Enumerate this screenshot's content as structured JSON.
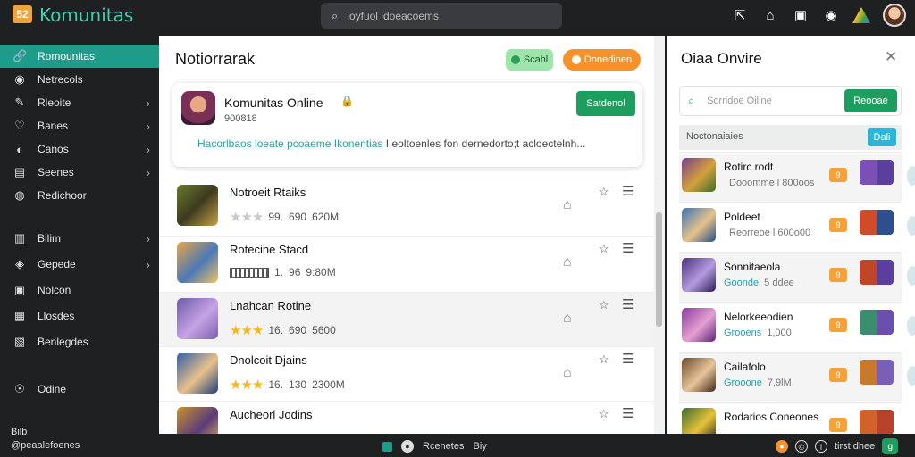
{
  "app": {
    "logo_text": "52",
    "brand": "Komunitas",
    "search_placeholder": "loyfuol ldoeacoems"
  },
  "top_icons": [
    "export-icon",
    "home-icon",
    "youtube-icon",
    "circle-icon",
    "rainbow-icon",
    "avatar"
  ],
  "sidebar": {
    "items": [
      {
        "icon": "🔗",
        "label": "Romounitas",
        "chevron": false,
        "active": true
      },
      {
        "icon": "◉",
        "label": "Netrecols",
        "chevron": false
      },
      {
        "icon": "✎",
        "label": "Rleoite",
        "chevron": true
      },
      {
        "icon": "♡",
        "label": "Banes",
        "chevron": true
      },
      {
        "icon": "◐",
        "label": "Canos",
        "chevron": true
      },
      {
        "icon": "▤",
        "label": "Seenes",
        "chevron": true
      },
      {
        "icon": "◍",
        "label": "Redichoor",
        "chevron": false
      },
      {
        "icon": "▥",
        "label": "Bilim",
        "chevron": true
      },
      {
        "icon": "◈",
        "label": "Gepede",
        "chevron": true
      },
      {
        "icon": "▣",
        "label": "Nolcon",
        "chevron": false
      },
      {
        "icon": "▦",
        "label": "Llosdes",
        "chevron": false
      },
      {
        "icon": "▧",
        "label": "Benlegdes",
        "chevron": false
      },
      {
        "icon": "☉",
        "label": "Odine",
        "chevron": false
      }
    ],
    "footer_line1": "Bilb",
    "footer_line2": "@pecaalefoenes"
  },
  "main": {
    "title": "Notiorrarak",
    "pill_green": "Scahl",
    "pill_orange": "Donedinen",
    "featured": {
      "name": "Komunitas Online",
      "lock": "🔒",
      "sub": "900818",
      "button": "Satdenol",
      "desc_highlight": "Hacorlbaos loeate pcoaeme Ikonentias",
      "desc_rest": " I eoltoenles fon dernedorto;t acloectelnh..."
    },
    "rows": [
      {
        "title": "Notroeit Rtaiks",
        "stars": "★★★",
        "star_style": "grey",
        "n1": "99.",
        "n2": "690",
        "size": "620M",
        "prefix": ""
      },
      {
        "title": "Rotecine Stacd",
        "stars": "",
        "star_style": "bar",
        "n1": "1.",
        "n2": "96",
        "size": "9:80M",
        "prefix": ""
      },
      {
        "title": "Lnahcan Rotine",
        "stars": "★★★",
        "star_style": "gold",
        "n1": "16.",
        "n2": "690",
        "size": "5600",
        "prefix": ""
      },
      {
        "title": "Dnolcoit Djains",
        "stars": "★★★",
        "star_style": "gold",
        "n1": "16.",
        "n2": "130",
        "size": "2300M",
        "prefix": ""
      },
      {
        "title": "Aucheorl Jodins",
        "stars": "★★★",
        "star_style": "dim",
        "n1": "",
        "n2": "",
        "size": "",
        "prefix": ""
      }
    ]
  },
  "right": {
    "title": "Oiaa Onvire",
    "search_placeholder": "Sorridoe Oiline",
    "search_button": "Reooae",
    "section_label": "Noctonaiaies",
    "section_button": "Dali",
    "rows": [
      {
        "name": "Rotirc rodt",
        "cat": "",
        "sub": "Dooomme  l 800oos",
        "badge": "9"
      },
      {
        "name": "Poldeet",
        "cat": "",
        "sub": "Reorreoe  l 600o00",
        "badge": "9"
      },
      {
        "name": "Sonnitaeola",
        "cat": "Goonde",
        "sub": "5 ddee",
        "badge": "9"
      },
      {
        "name": "Nelorkeeodien",
        "cat": "Grooens",
        "sub": "1,000",
        "badge": "9"
      },
      {
        "name": "Cailafolo",
        "cat": "Grooone",
        "sub": "7,9lM",
        "badge": "9"
      },
      {
        "name": "Rodarios Coneones",
        "cat": "",
        "sub": "",
        "badge": "9"
      }
    ]
  },
  "bottom": {
    "left": "@peaalefoenes",
    "mid_label": "Rcenetes",
    "mid_label2": "Biy",
    "right_text": "tirst dhee",
    "right_badge": "g"
  }
}
